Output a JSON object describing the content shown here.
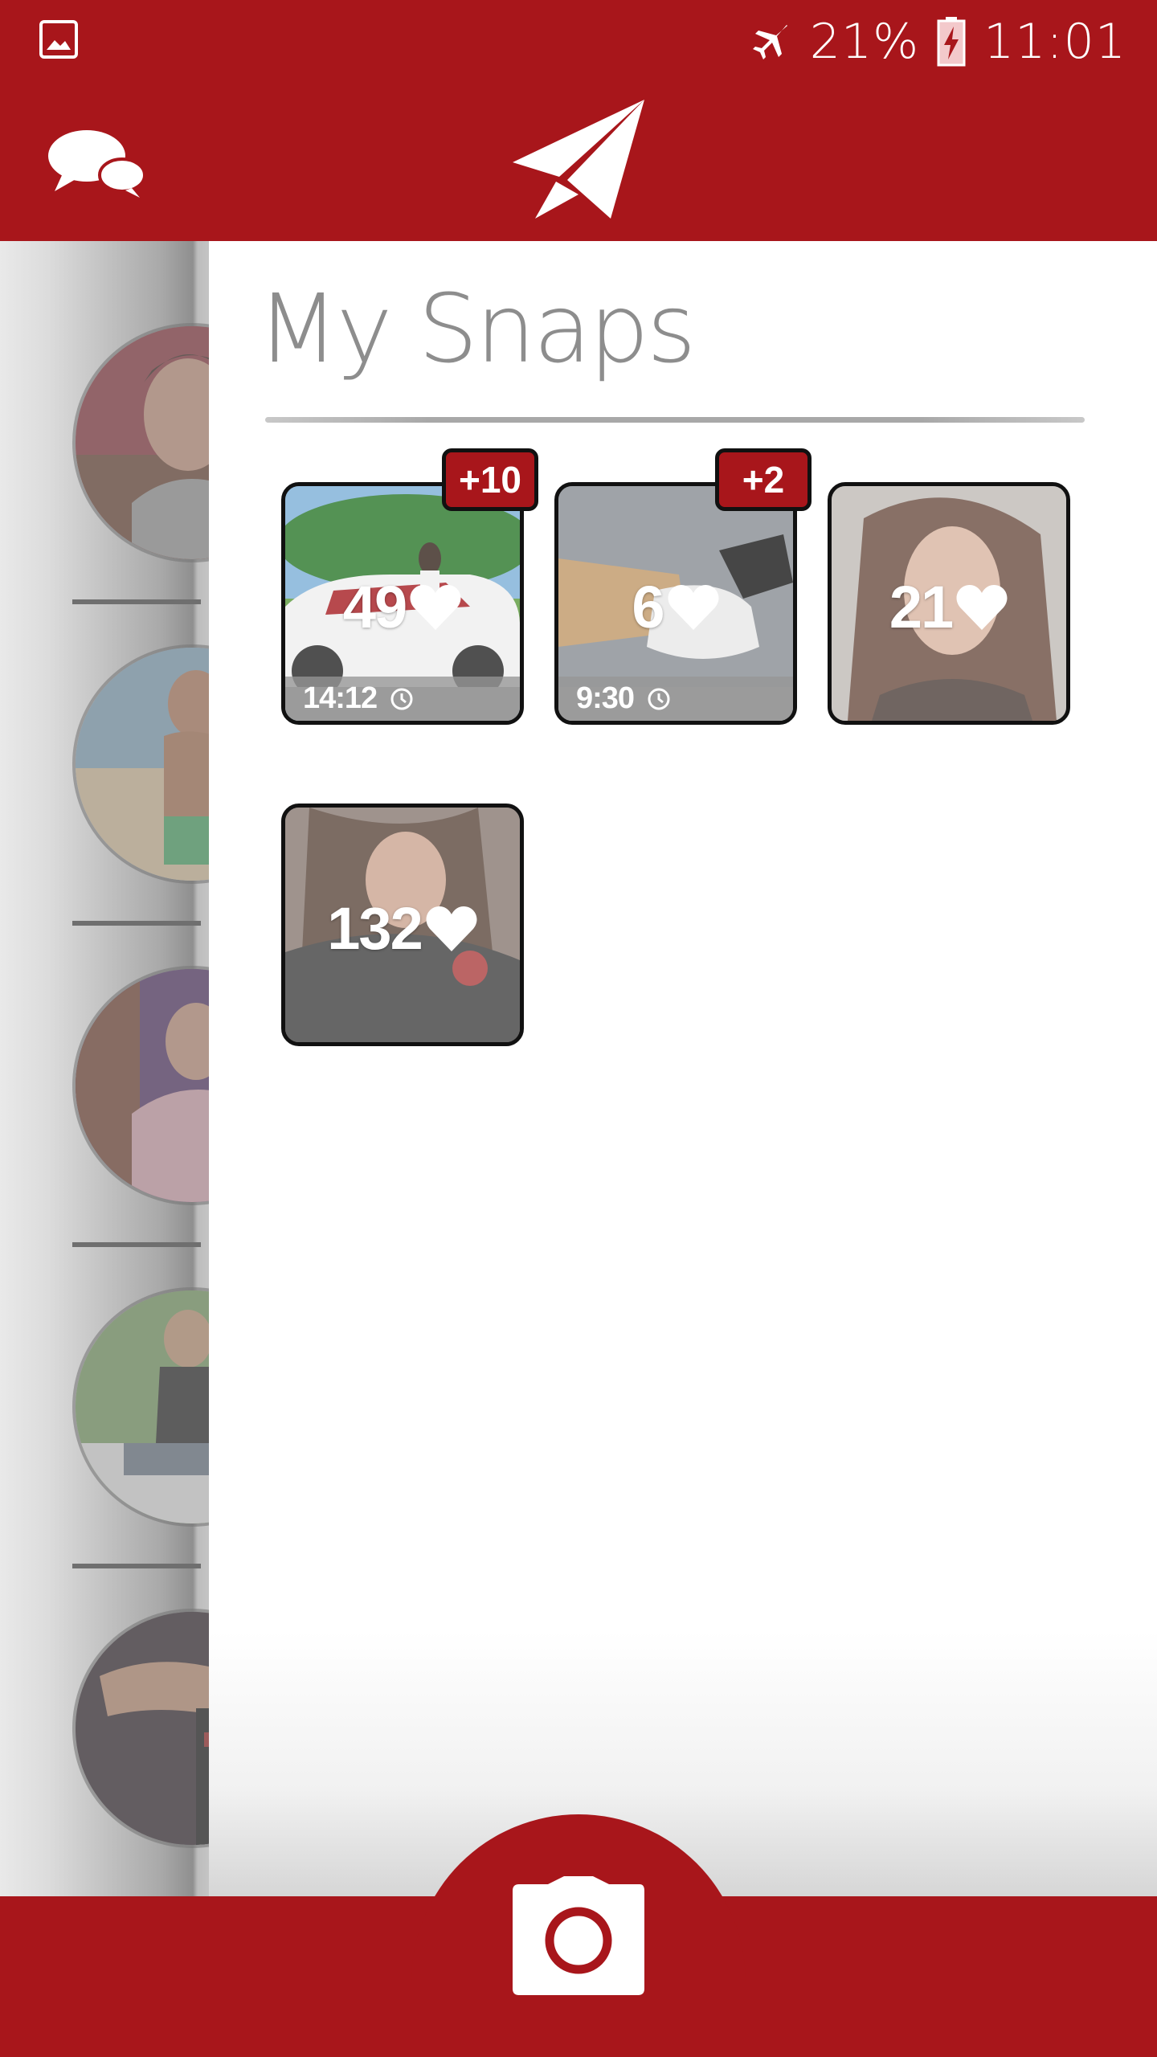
{
  "status_bar": {
    "battery": "21%",
    "time": "11:01"
  },
  "toolbar": {
    "left_icon": "chat-bubbles-icon",
    "center_icon": "paper-plane-icon"
  },
  "page": {
    "title": "My Snaps"
  },
  "snaps": [
    {
      "likes": "49",
      "badge": "+10",
      "time": "14:12"
    },
    {
      "likes": "6",
      "badge": "+2",
      "time": "9:30"
    },
    {
      "likes": "21"
    },
    {
      "likes": "132"
    }
  ],
  "bottom_bar": {
    "center_icon": "camera-icon"
  },
  "colors": {
    "brand_red": "#a8161b",
    "title_gray": "#8d8d8d"
  }
}
